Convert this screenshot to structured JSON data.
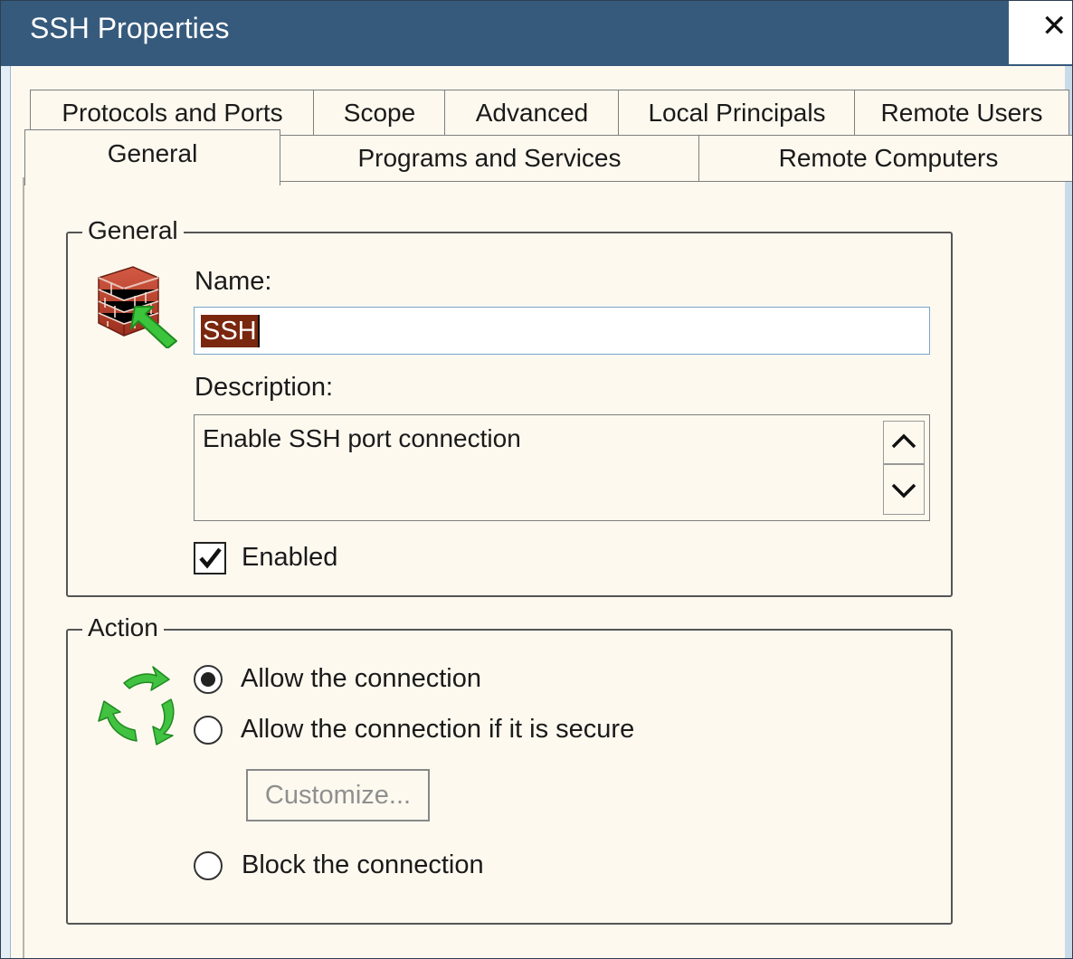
{
  "window": {
    "title": "SSH Properties",
    "close_glyph": "✕"
  },
  "tabs": {
    "row1": [
      "Protocols and Ports",
      "Scope",
      "Advanced",
      "Local Principals",
      "Remote Users"
    ],
    "row2": [
      "General",
      "Programs and Services",
      "Remote Computers"
    ],
    "active": "General"
  },
  "general": {
    "group_label": "General",
    "name_label": "Name:",
    "name_value": "SSH",
    "description_label": "Description:",
    "description_value": "Enable SSH port connection",
    "enabled_label": "Enabled",
    "enabled_checked": true,
    "icon": "firewall-rule-icon"
  },
  "action": {
    "group_label": "Action",
    "icon": "refresh-arrows-icon",
    "options": [
      {
        "label": "Allow the connection",
        "selected": true
      },
      {
        "label": "Allow the connection if it is secure",
        "selected": false
      },
      {
        "label": "Block the connection",
        "selected": false
      }
    ],
    "customize_label": "Customize..."
  },
  "colors": {
    "titlebar": "#365a7c",
    "dialog_bg": "#fdf9ef",
    "selection": "#7a2710",
    "arrow_green": "#2fb82f"
  }
}
